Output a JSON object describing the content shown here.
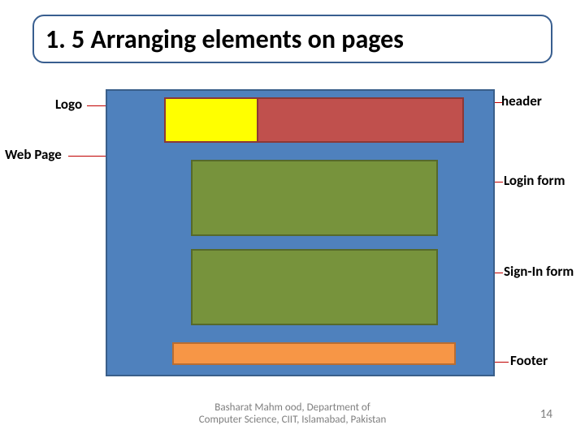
{
  "title": "1. 5 Arranging elements on pages",
  "labels": {
    "logo": "Logo",
    "webpage": "Web Page",
    "header": "header",
    "login": "Login form",
    "signin": "Sign-In form",
    "footer": "Footer"
  },
  "footer": {
    "line1": "Basharat Mahm ood, Department of",
    "line2": "Computer Science, CIIT, Islamabad, Pakistan"
  },
  "page_number": "14"
}
